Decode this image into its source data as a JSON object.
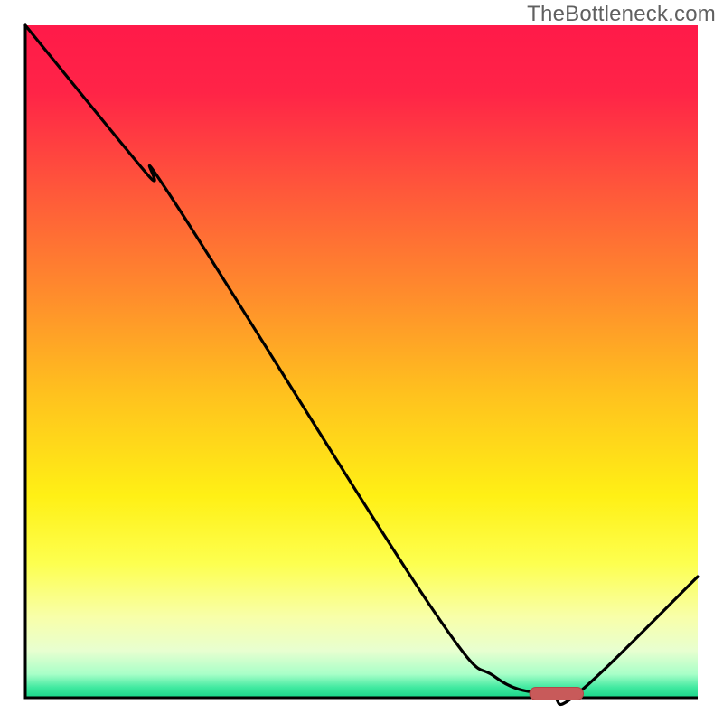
{
  "watermark": "TheBottleneck.com",
  "colors": {
    "gradient_stops": [
      {
        "offset": 0.0,
        "color": "#ff1a49"
      },
      {
        "offset": 0.1,
        "color": "#ff2447"
      },
      {
        "offset": 0.25,
        "color": "#ff593a"
      },
      {
        "offset": 0.4,
        "color": "#ff8c2c"
      },
      {
        "offset": 0.55,
        "color": "#ffc21e"
      },
      {
        "offset": 0.7,
        "color": "#fff015"
      },
      {
        "offset": 0.8,
        "color": "#fdff4f"
      },
      {
        "offset": 0.88,
        "color": "#f8ffa9"
      },
      {
        "offset": 0.93,
        "color": "#e8ffd0"
      },
      {
        "offset": 0.965,
        "color": "#a8ffc8"
      },
      {
        "offset": 0.985,
        "color": "#40e9a0"
      },
      {
        "offset": 1.0,
        "color": "#18d488"
      }
    ],
    "axis": "#000000",
    "curve": "#000000",
    "marker_fill": "#c85a5a",
    "marker_stroke": "#b24848"
  },
  "chart_data": {
    "type": "line",
    "title": "",
    "xlabel": "",
    "ylabel": "",
    "xlim": [
      0,
      100
    ],
    "ylim": [
      0,
      100
    ],
    "series": [
      {
        "name": "bottleneck-curve",
        "x": [
          0,
          18,
          22,
          60,
          70,
          78,
          82,
          100
        ],
        "values": [
          100,
          78,
          74,
          14,
          3,
          0.5,
          0.5,
          18
        ]
      }
    ],
    "marker": {
      "name": "optimal-range",
      "x_start": 75,
      "x_end": 83,
      "y": 0.6,
      "shape": "rounded-bar"
    },
    "grid": false,
    "legend": false
  }
}
